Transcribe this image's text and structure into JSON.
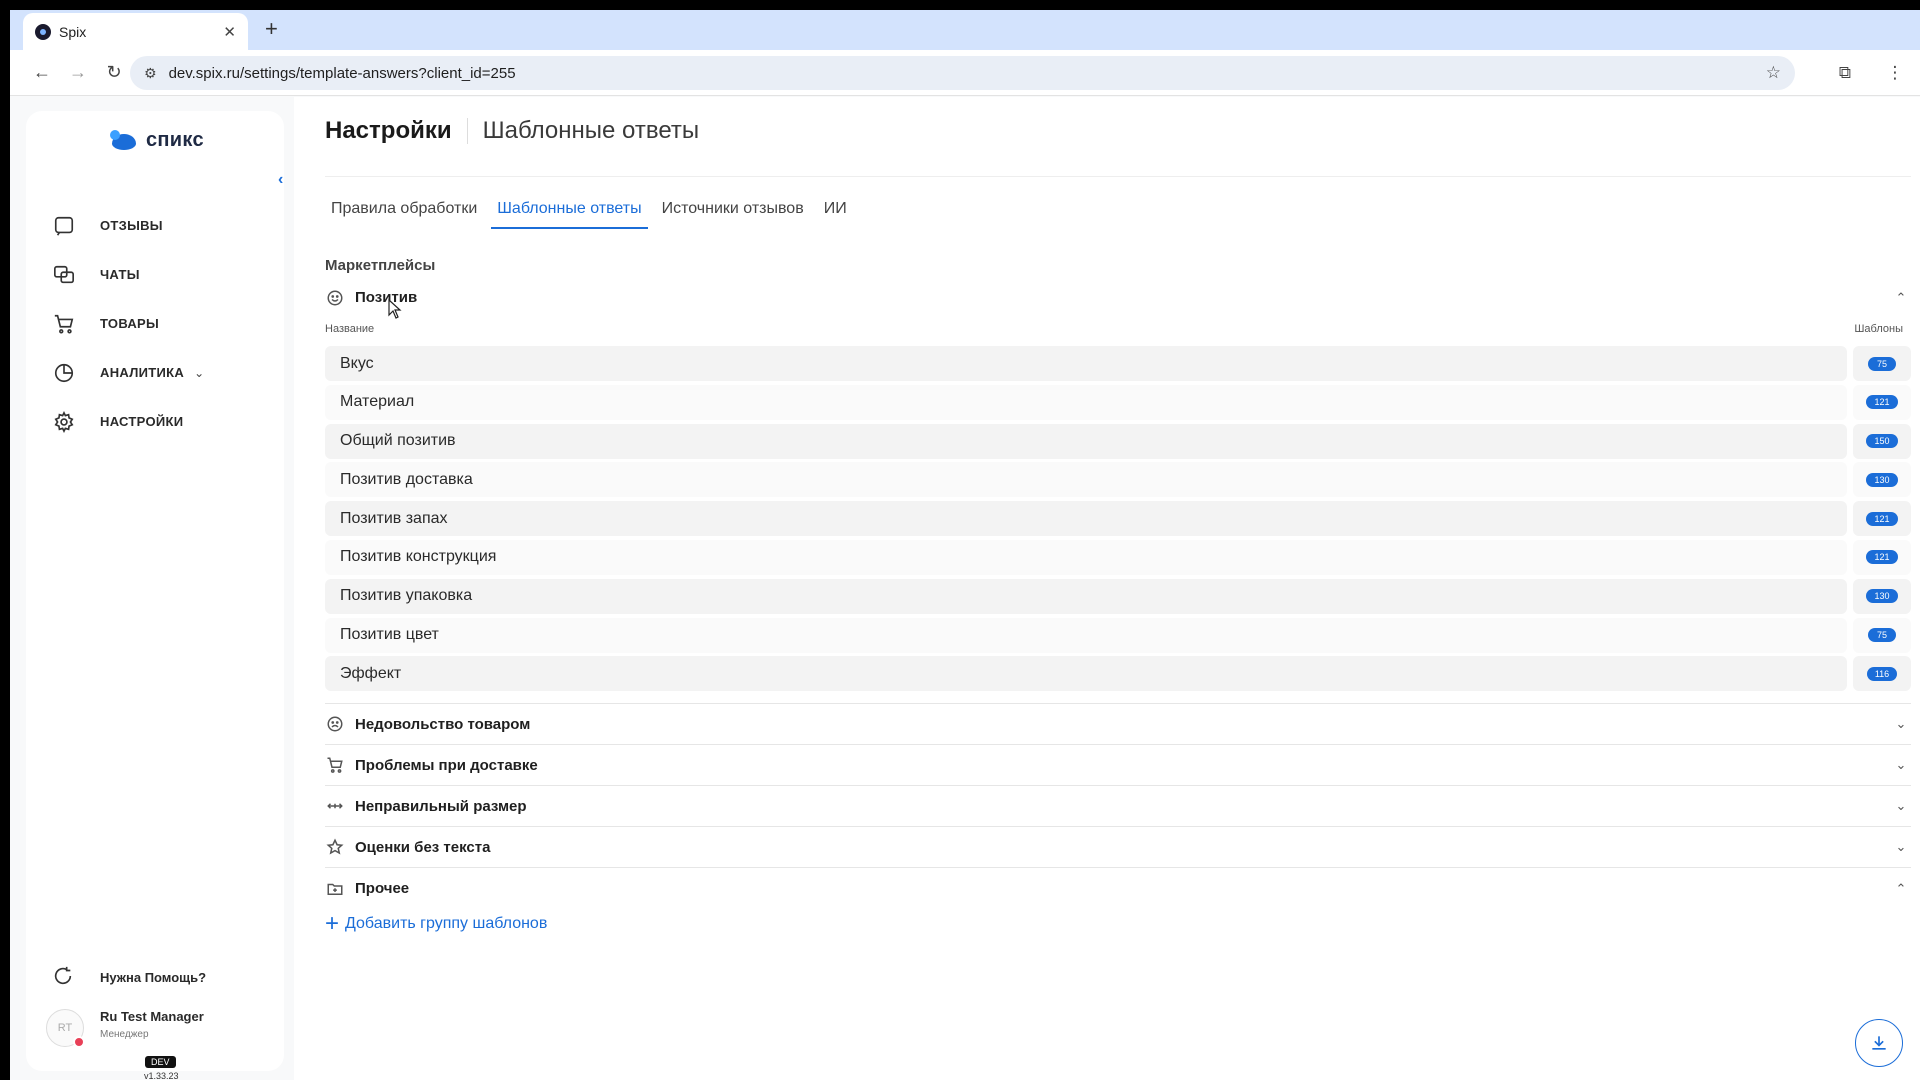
{
  "browser": {
    "tab_title": "Spix",
    "tab_close": "✕",
    "new_tab": "+",
    "url": "dev.spix.ru/settings/template-answers?client_id=255"
  },
  "sidebar": {
    "logo_text": "спикс",
    "items": [
      {
        "label": "ОТЗЫВЫ",
        "icon": "chat-bubble-icon"
      },
      {
        "label": "ЧАТЫ",
        "icon": "chats-icon"
      },
      {
        "label": "ТОВАРЫ",
        "icon": "cart-icon"
      },
      {
        "label": "АНАЛИТИКА",
        "icon": "pie-chart-icon"
      },
      {
        "label": "НАСТРОЙКИ",
        "icon": "gear-icon"
      }
    ],
    "help_label": "Нужна Помощь?",
    "user": {
      "initials": "RT",
      "name": "Ru Test Manager",
      "role": "Менеджер"
    },
    "env_badge": "DEV",
    "version": "v1.33.23"
  },
  "header": {
    "title": "Настройки",
    "subtitle": "Шаблонные ответы"
  },
  "tabs": [
    "Правила обработки",
    "Шаблонные ответы",
    "Источники отзывов",
    "ИИ"
  ],
  "section_title": "Маркетплейсы",
  "columns": {
    "name": "Название",
    "templates": "Шаблоны"
  },
  "groups": [
    {
      "title": "Позитив",
      "icon": "smile-icon",
      "expanded": true
    },
    {
      "title": "Недовольство товаром",
      "icon": "frown-icon",
      "expanded": false
    },
    {
      "title": "Проблемы при доставке",
      "icon": "delivery-cart-icon",
      "expanded": false
    },
    {
      "title": "Неправильный размер",
      "icon": "resize-arrows-icon",
      "expanded": false
    },
    {
      "title": "Оценки без текста",
      "icon": "star-icon",
      "expanded": false
    },
    {
      "title": "Прочее",
      "icon": "folder-plus-icon",
      "expanded": true
    }
  ],
  "rows": [
    {
      "name": "Вкус",
      "count": "75"
    },
    {
      "name": "Материал",
      "count": "121"
    },
    {
      "name": "Общий позитив",
      "count": "150"
    },
    {
      "name": "Позитив доставка",
      "count": "130"
    },
    {
      "name": "Позитив запах",
      "count": "121"
    },
    {
      "name": "Позитив конструкция",
      "count": "121"
    },
    {
      "name": "Позитив упаковка",
      "count": "130"
    },
    {
      "name": "Позитив цвет",
      "count": "75"
    },
    {
      "name": "Эффект",
      "count": "116"
    }
  ],
  "add_group_label": "Добавить группу шаблонов",
  "colors": {
    "accent": "#1b6dd8",
    "tab_strip": "#d3e3fd"
  }
}
